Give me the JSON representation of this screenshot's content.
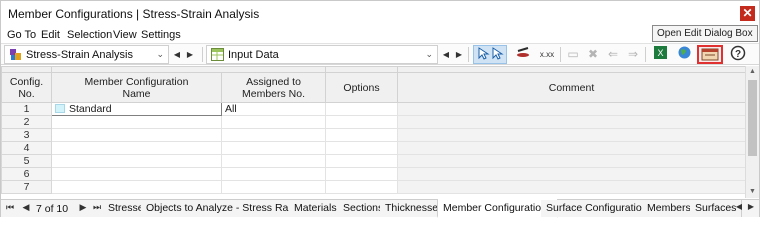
{
  "window": {
    "title": "Member Configurations | Stress-Strain Analysis",
    "close": "✕"
  },
  "menu": [
    "Go To",
    "Edit",
    "Selection",
    "View",
    "Settings"
  ],
  "tooltip": "Open Edit Dialog Box",
  "toolbar": {
    "module_combo": "Stress-Strain Analysis",
    "data_combo": "Input Data",
    "prev_arrow": "◀",
    "next_arrow": "▶",
    "combo_arrow": "⌄",
    "xxx_label": "x.xx"
  },
  "table": {
    "headers": {
      "config_no": "Config.\nNo.",
      "name": "Member Configuration\nName",
      "assigned": "Assigned to\nMembers No.",
      "options": "Options",
      "comment": "Comment"
    },
    "rows": [
      {
        "no": "1",
        "name": "Standard",
        "assigned": "All",
        "options": "",
        "comment": ""
      },
      {
        "no": "2",
        "name": "",
        "assigned": "",
        "options": "",
        "comment": ""
      },
      {
        "no": "3",
        "name": "",
        "assigned": "",
        "options": "",
        "comment": ""
      },
      {
        "no": "4",
        "name": "",
        "assigned": "",
        "options": "",
        "comment": ""
      },
      {
        "no": "5",
        "name": "",
        "assigned": "",
        "options": "",
        "comment": ""
      },
      {
        "no": "6",
        "name": "",
        "assigned": "",
        "options": "",
        "comment": ""
      },
      {
        "no": "7",
        "name": "",
        "assigned": "",
        "options": "",
        "comment": ""
      }
    ]
  },
  "footer": {
    "pager": "7 of 10",
    "tabs": [
      "Stresses",
      "Objects to Analyze - Stress Ranges",
      "Materials",
      "Sections",
      "Thicknesses",
      "Member Configurations",
      "Surface Configurations",
      "Members",
      "Surfaces"
    ],
    "active_tab": "Member Configurations"
  },
  "colors": {
    "accent": "#cfe3f5",
    "highlight": "#e03030",
    "close": "#c42b1c",
    "swatch": "#d3f3fb"
  }
}
